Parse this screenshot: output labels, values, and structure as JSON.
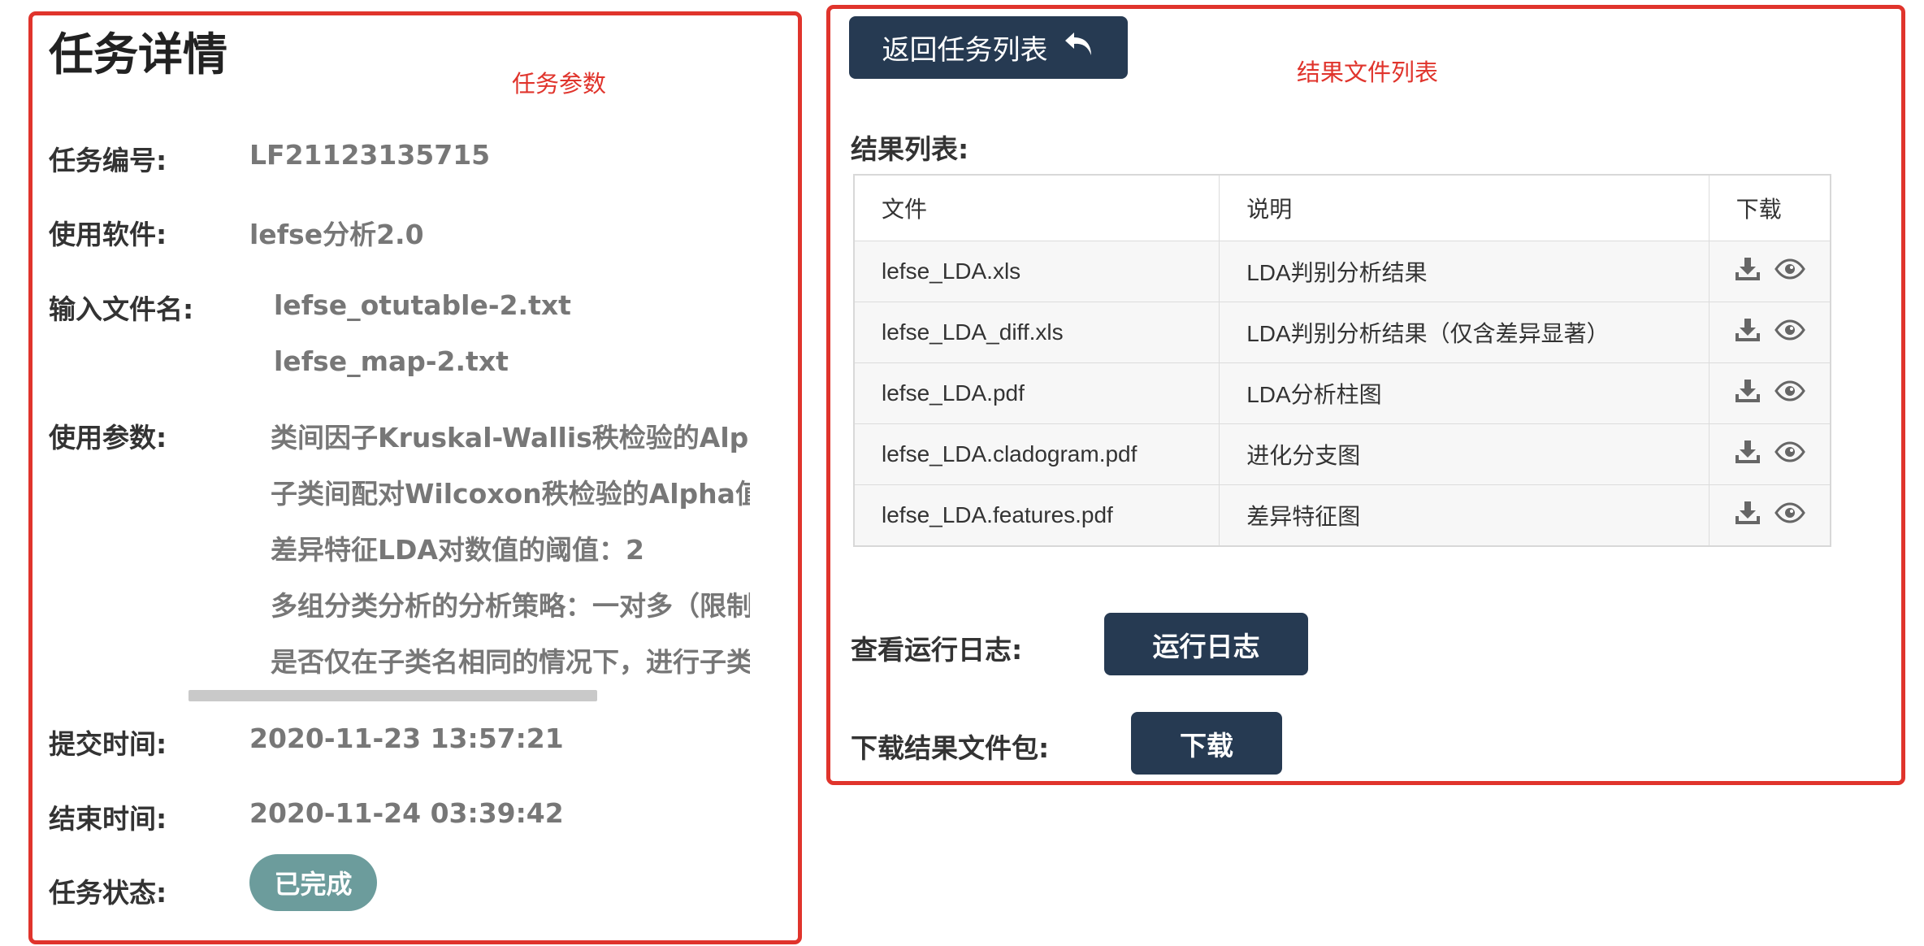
{
  "left": {
    "title": "任务详情",
    "annotation": "任务参数",
    "task_id_label": "任务编号:",
    "task_id": "LF21123135715",
    "software_label": "使用软件:",
    "software": "lefse分析2.0",
    "input_label": "输入文件名:",
    "input_files": [
      "lefse_otutable-2.txt",
      "lefse_map-2.txt"
    ],
    "params_label": "使用参数:",
    "params": [
      "类间因子Kruskal-Wallis秩检验的Alpha值",
      "子类间配对Wilcoxon秩检验的Alpha值：(",
      "差异特征LDA对数值的阈值：2",
      "多组分类分析的分析策略：一对多（限制",
      "是否仅在子类名相同的情况下，进行子类间"
    ],
    "submit_label": "提交时间:",
    "submit_time": "2020-11-23 13:57:21",
    "end_label": "结束时间:",
    "end_time": "2020-11-24 03:39:42",
    "status_label": "任务状态:",
    "status": "已完成",
    "status_color": "#6c9c9c"
  },
  "right": {
    "back_button": "返回任务列表",
    "back_icon": "reply-arrow-icon",
    "annotation": "结果文件列表",
    "results_label": "结果列表:",
    "table": {
      "headers": [
        "文件",
        "说明",
        "下载"
      ],
      "rows": [
        {
          "file": "lefse_LDA.xls",
          "desc": "LDA判别分析结果"
        },
        {
          "file": "lefse_LDA_diff.xls",
          "desc": "LDA判别分析结果（仅含差异显著）"
        },
        {
          "file": "lefse_LDA.pdf",
          "desc": "LDA分析柱图"
        },
        {
          "file": "lefse_LDA.cladogram.pdf",
          "desc": "进化分支图"
        },
        {
          "file": "lefse_LDA.features.pdf",
          "desc": "差异特征图"
        }
      ]
    },
    "log_label": "查看运行日志:",
    "log_button": "运行日志",
    "pkg_label": "下载结果文件包:",
    "pkg_button": "下载"
  },
  "colors": {
    "annotation_red": "#e0342c",
    "button_dark": "#263a52"
  }
}
